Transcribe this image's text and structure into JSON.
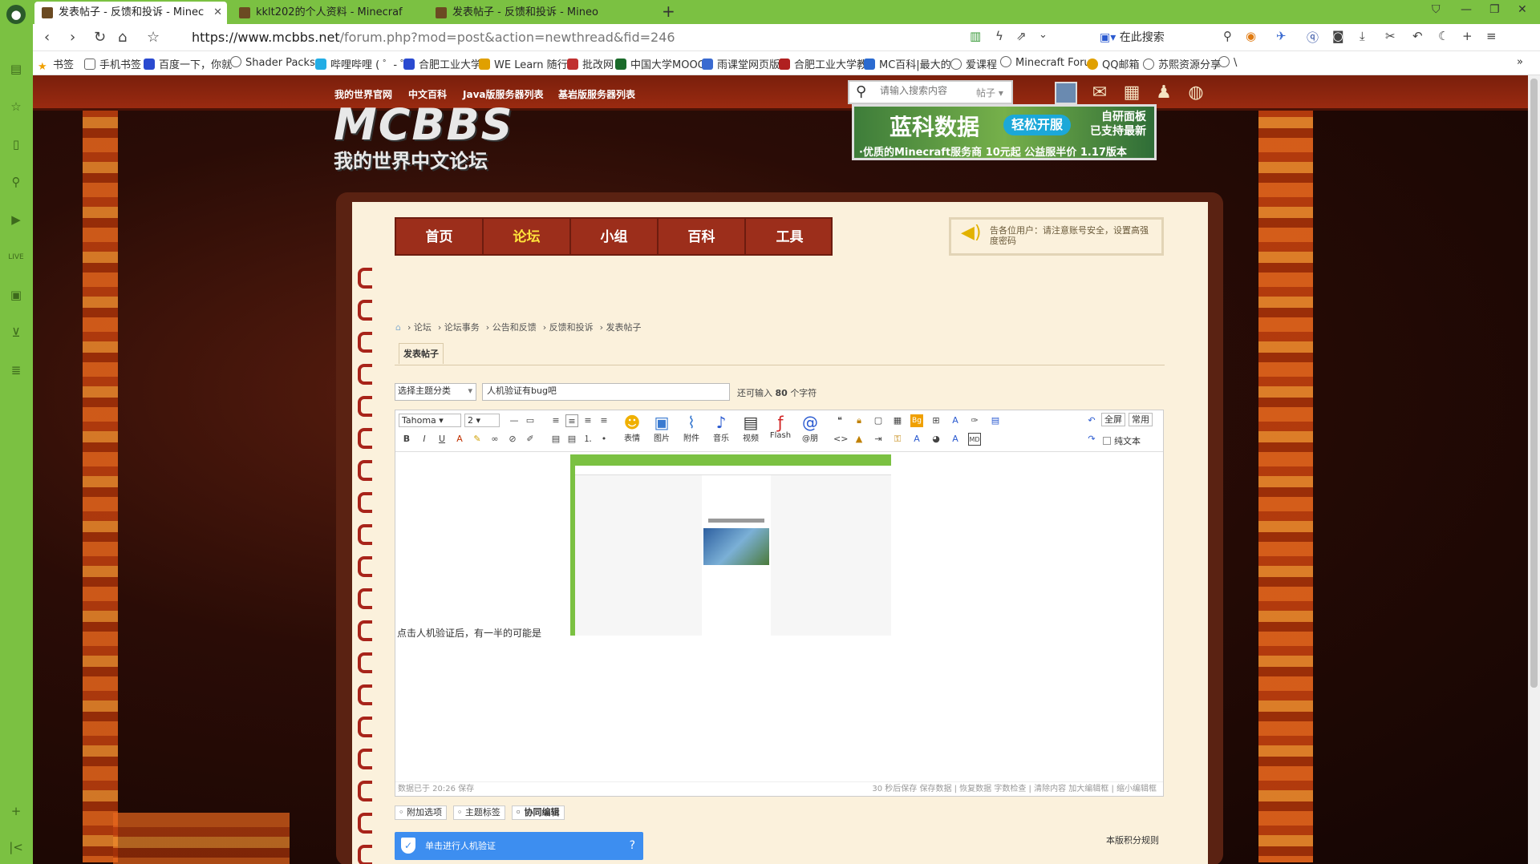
{
  "browser": {
    "tabs": [
      {
        "label": "发表帖子 - 反馈和投诉 - Minec",
        "active": true
      },
      {
        "label": "kklt202的个人资料 - Minecraf",
        "active": false
      },
      {
        "label": "发表帖子 - 反馈和投诉 - Mineo",
        "active": false
      }
    ],
    "url_main": "https://www.mcbbs.net",
    "url_rest": "/forum.php?mod=post&action=newthread&fid=246",
    "search_label": "在此搜索",
    "bookmarks": [
      "书签",
      "手机书签",
      "百度一下，你就",
      "Shader Packs",
      "哔哩哔哩 ( ゜- ゜",
      "合肥工业大学",
      "WE Learn 随行",
      "批改网",
      "中国大学MOOC",
      "雨课堂网页版",
      "合肥工业大学教",
      "MC百科|最大的",
      "爱课程",
      "Minecraft Foru",
      "QQ邮箱",
      "苏熙资源分享",
      "\\"
    ]
  },
  "site": {
    "toplinks": [
      "我的世界官网",
      "中文百科",
      "Java版服务器列表",
      "基岩版服务器列表"
    ],
    "search_placeholder": "请输入搜索内容",
    "search_type": "帖子",
    "logo_line1": "MCBBS",
    "logo_line2": "我的世界中文论坛",
    "banner": {
      "title": "蓝科数据",
      "button": "轻松开服",
      "right1": "自研面板",
      "right2": "已支持最新",
      "bottom": "·优质的Minecraft服务商 10元起 公益服半价 1.17版本"
    },
    "mainnav": [
      "首页",
      "论坛",
      "小组",
      "百科",
      "工具"
    ],
    "notice": "告各位用户：请注意账号安全，设置高强度密码",
    "breadcrumbs": [
      "论坛",
      "论坛事务",
      "公告和反馈",
      "反馈和投诉",
      "发表帖子"
    ]
  },
  "post": {
    "tab": "发表帖子",
    "category": "选择主题分类",
    "subject": "人机验证有bug吧",
    "chars_prefix": "还可输入",
    "chars_count": "80",
    "chars_suffix": "个字符",
    "font": "Tahoma",
    "size": "2",
    "tools": [
      "表情",
      "图片",
      "附件",
      "音乐",
      "视频",
      "Flash",
      "@朋"
    ],
    "full": "全屏",
    "common": "常用",
    "plaintext": "纯文本",
    "body_text": "点击人机验证后，有一半的可能是",
    "status_left": "数据已于 20:26 保存",
    "status_right": "30 秒后保存 保存数据 | 恢复数据    字数检查 | 清除内容    加大编辑框 | 缩小编辑框",
    "options": [
      "附加选项",
      "主题标签",
      "协同编辑"
    ],
    "captcha": "单击进行人机验证",
    "rules": "本版积分规则"
  }
}
